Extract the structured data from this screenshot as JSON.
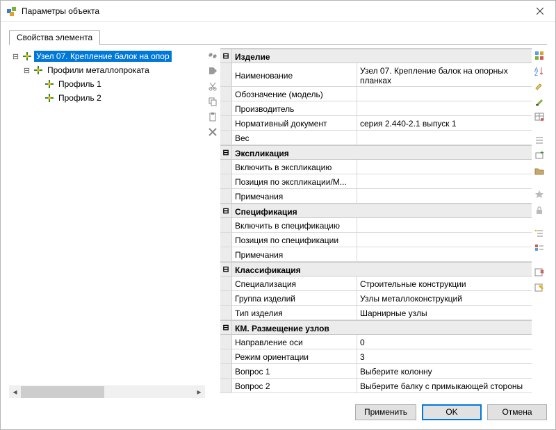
{
  "window": {
    "title": "Параметры объекта"
  },
  "tab": {
    "label": "Свойства элемента"
  },
  "tree": {
    "root": {
      "label": "Узел 07. Крепление балок на опор"
    },
    "group": {
      "label": "Профили металлопроката"
    },
    "c1": {
      "label": "Профиль 1"
    },
    "c2": {
      "label": "Профиль 2"
    }
  },
  "groups": {
    "product": "Изделие",
    "explication": "Экспликация",
    "spec": "Спецификация",
    "classif": "Классификация",
    "km": "КМ. Размещение узлов"
  },
  "product": {
    "name_label": "Наименование",
    "name_value": "Узел 07. Крепление балок на опорных планках",
    "model_label": "Обозначение (модель)",
    "model_value": "",
    "maker_label": "Производитель",
    "maker_value": "",
    "norm_label": "Нормативный документ",
    "norm_value": "серия 2.440-2.1 выпуск 1",
    "weight_label": "Вес",
    "weight_value": ""
  },
  "explication": {
    "include_label": "Включить в экспликацию",
    "include_value": "",
    "pos_label": "Позиция по экспликации/М...",
    "pos_value": "",
    "note_label": "Примечания",
    "note_value": ""
  },
  "spec": {
    "include_label": "Включить в спецификацию",
    "include_value": "",
    "pos_label": "Позиция по спецификации",
    "pos_value": "",
    "note_label": "Примечания",
    "note_value": ""
  },
  "classif": {
    "spec_label": "Специализация",
    "spec_value": "Строительные конструкции",
    "group_label": "Группа изделий",
    "group_value": "Узлы металлоконструкций",
    "type_label": "Тип изделия",
    "type_value": "Шарнирные узлы"
  },
  "km": {
    "axis_label": "Направление оси",
    "axis_value": "0",
    "orient_label": "Режим ориентации",
    "orient_value": "3",
    "q1_label": "Вопрос 1",
    "q1_value": "Выберите колонну",
    "q2_label": "Вопрос 2",
    "q2_value": "Выберите балку с примыкающей стороны"
  },
  "footer": {
    "apply": "Применить",
    "ok": "OK",
    "cancel": "Отмена"
  }
}
